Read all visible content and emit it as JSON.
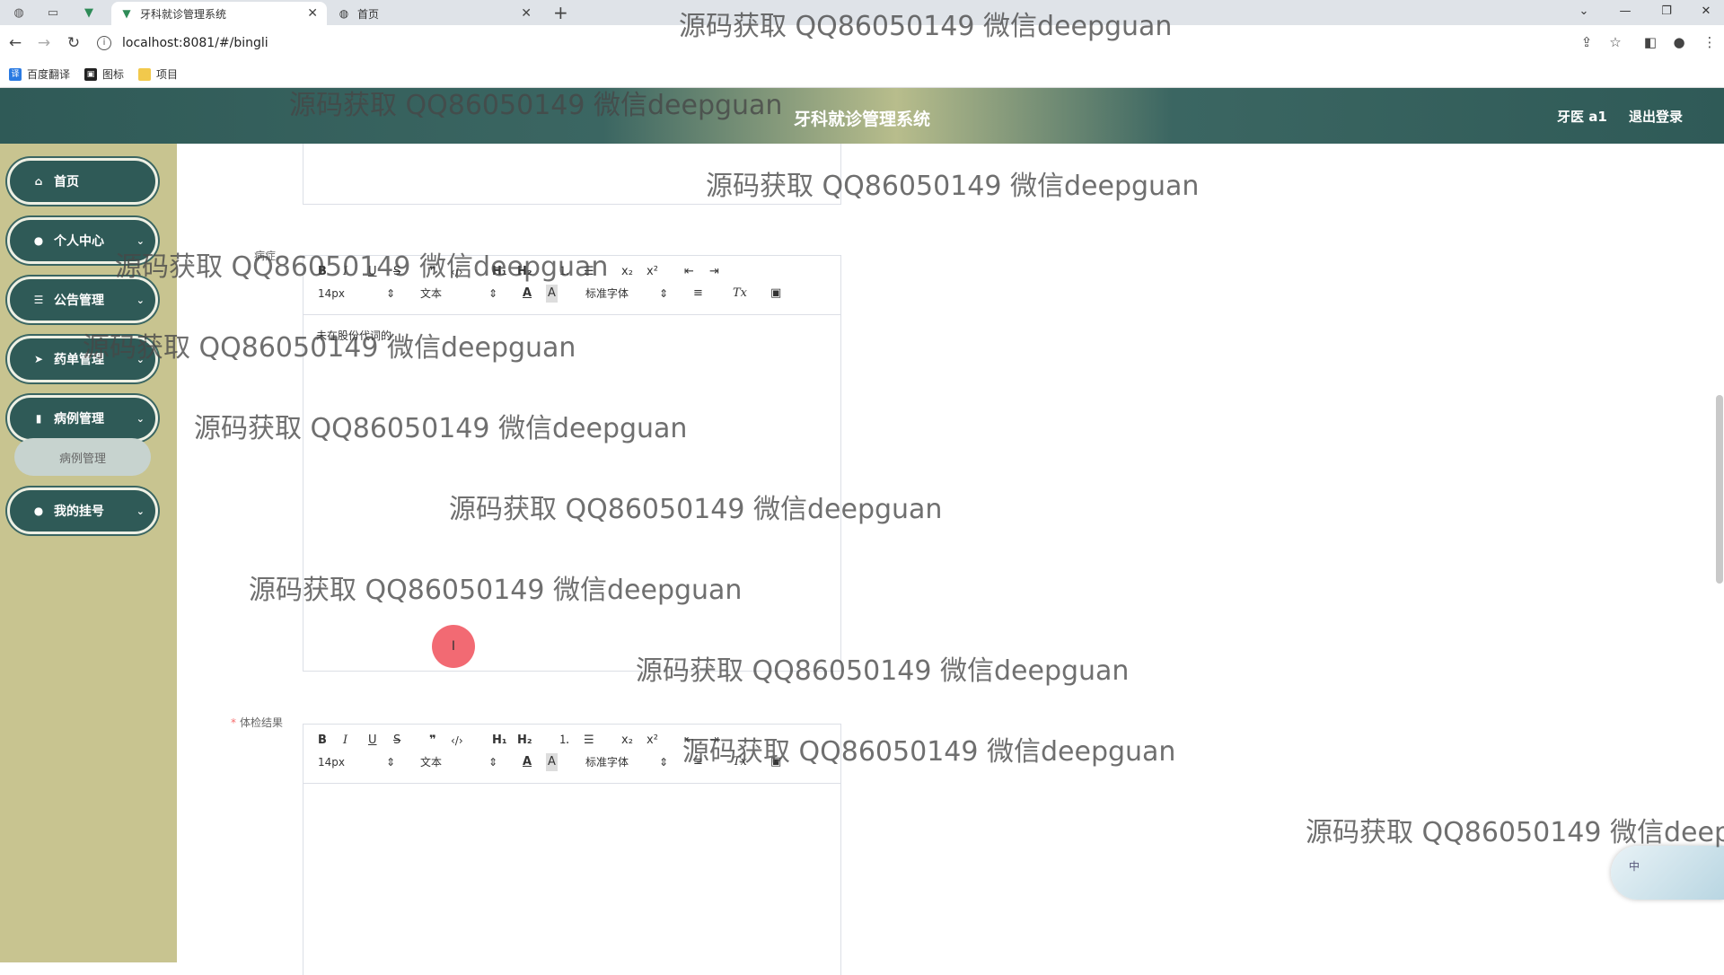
{
  "browser": {
    "tabs": [
      {
        "title": "牙科就诊管理系统",
        "active": true
      },
      {
        "title": "首页",
        "active": false
      }
    ],
    "url": "localhost:8081/#/bingli",
    "bookmarks": [
      "百度翻译",
      "图标",
      "项目"
    ]
  },
  "header": {
    "title": "牙科就诊管理系统",
    "user": "牙医 a1",
    "logout": "退出登录"
  },
  "sidebar": {
    "items": [
      {
        "label": "首页",
        "icon": "home-icon",
        "has_submenu": false
      },
      {
        "label": "个人中心",
        "icon": "user-icon",
        "has_submenu": true
      },
      {
        "label": "公告管理",
        "icon": "list-icon",
        "has_submenu": true
      },
      {
        "label": "药单管理",
        "icon": "send-icon",
        "has_submenu": true
      },
      {
        "label": "病例管理",
        "icon": "bar-chart-icon",
        "has_submenu": true
      },
      {
        "label": "我的挂号",
        "icon": "location-icon",
        "has_submenu": true
      }
    ],
    "active_submenu": "病例管理"
  },
  "form": {
    "field1_label": "病症",
    "field1_content": "未在股份代词的",
    "field2_label": "体检结果",
    "field2_content": ""
  },
  "toolbar": {
    "bold": "B",
    "italic": "I",
    "underline": "U",
    "strike": "S",
    "quote": "❞",
    "code": "‹/›",
    "h1": "H₁",
    "h2": "H₂",
    "ol": "⒈",
    "ul": "☰",
    "sub": "x₂",
    "sup": "x²",
    "outdent": "⇤",
    "indent": "⇥",
    "size": "14px",
    "header": "文本",
    "font": "标准字体",
    "color": "A",
    "bg": "A",
    "align": "≡",
    "clean": "Tx",
    "image": "▣"
  },
  "watermark": "源码获取 QQ86050149 微信deepguan",
  "cursor_glyph": "I",
  "widget_text": "中"
}
